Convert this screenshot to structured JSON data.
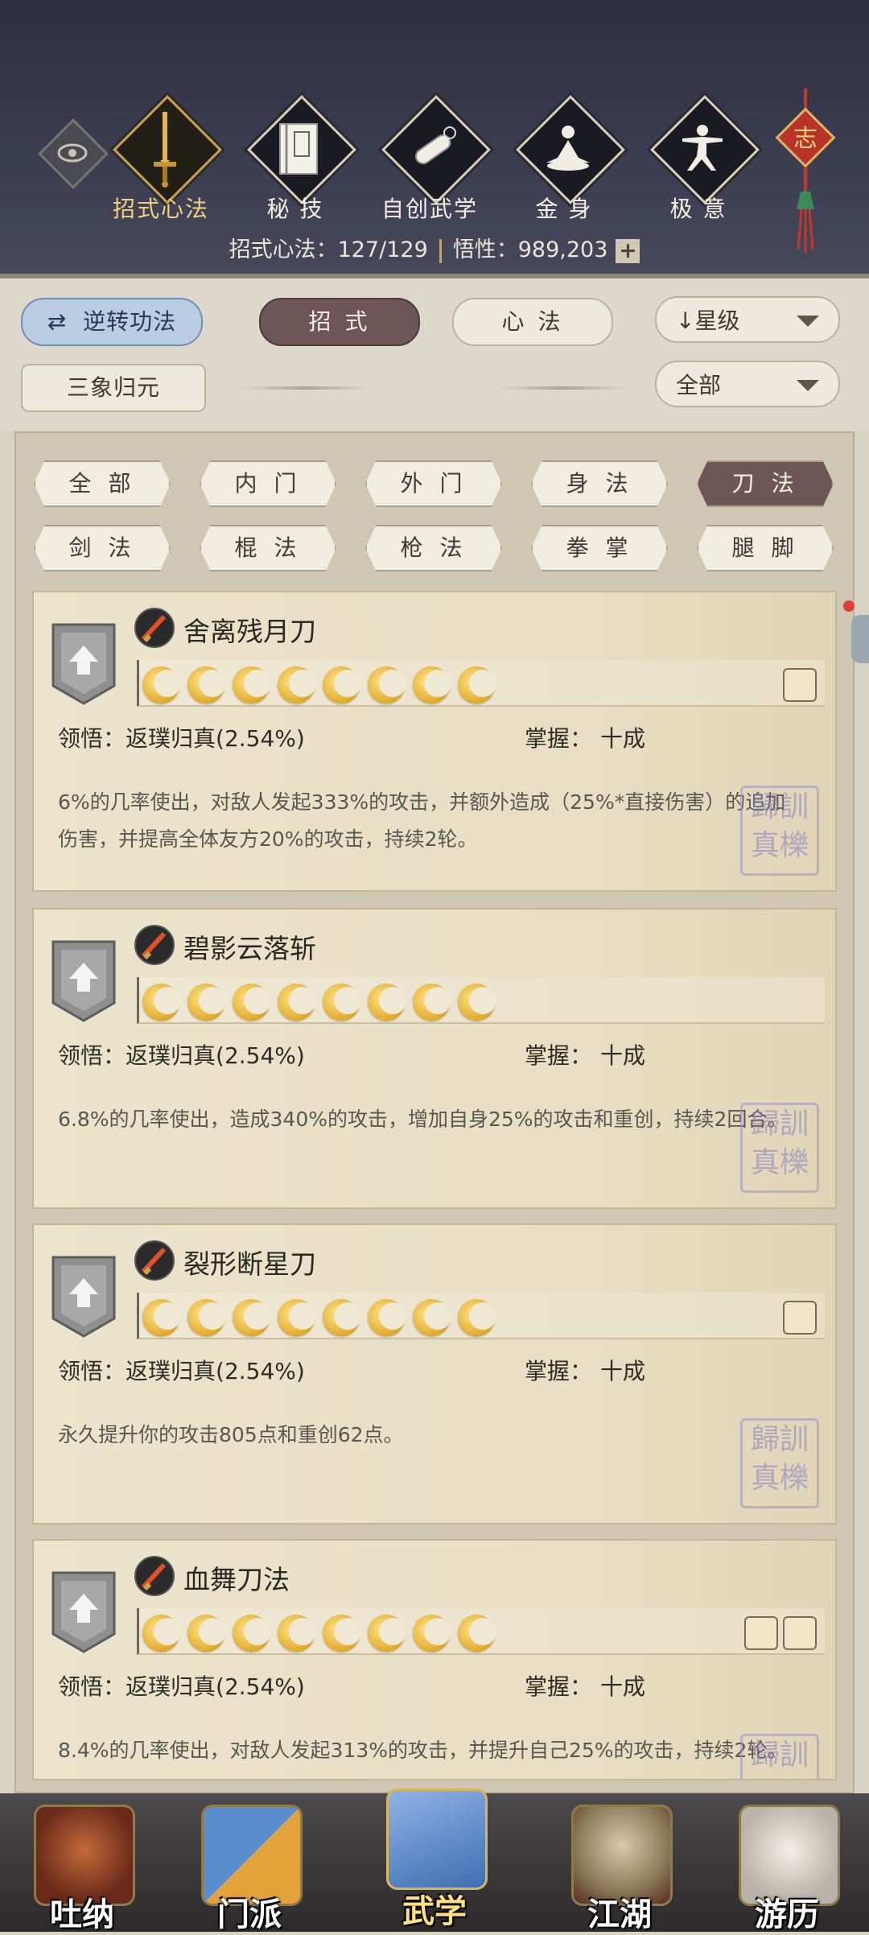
{
  "header": {
    "tabs": [
      {
        "label": "招式心法",
        "icon": "sword-icon",
        "active": true
      },
      {
        "label": "秘 技",
        "icon": "book-icon",
        "active": false
      },
      {
        "label": "自创武学",
        "icon": "scroll-icon",
        "active": false
      },
      {
        "label": "金 身",
        "icon": "meditation-icon",
        "active": false
      },
      {
        "label": "极 意",
        "icon": "martial-stance-icon",
        "active": false
      }
    ],
    "knot_char": "志",
    "stats": {
      "moves_label": "招式心法：",
      "moves_value": "127/129",
      "insight_label": "悟性：",
      "insight_value": "989,203",
      "plus_label": "+"
    }
  },
  "filters": {
    "reverse_label": "逆转功法",
    "moves_tab": "招 式",
    "heart_tab": "心 法",
    "sort_label": "星级",
    "sanxiang_label": "三象归元",
    "scope_label": "全部"
  },
  "categories": [
    "全 部",
    "内 门",
    "外 门",
    "身 法",
    "刀 法",
    "剑 法",
    "棍 法",
    "枪 法",
    "拳 掌",
    "腿 脚"
  ],
  "active_category": "刀 法",
  "cards": [
    {
      "name": "舍离残月刀",
      "stars": 8,
      "insight_label": "领悟：",
      "insight_value": "返璞归真(2.54%)",
      "mastery_label": "掌握：",
      "mastery_value": "十成",
      "desc": "6%的几率使出，对敌人发起333%的攻击，并额外造成（25%*直接伤害）的追加伤害，并提高全体友方20%的攻击，持续2轮。",
      "seal": "歸訓真櫟"
    },
    {
      "name": "碧影云落斩",
      "stars": 8,
      "insight_label": "领悟：",
      "insight_value": "返璞归真(2.54%)",
      "mastery_label": "掌握：",
      "mastery_value": "十成",
      "desc": "6.8%的几率使出，造成340%的攻击，增加自身25%的攻击和重创，持续2回合。",
      "seal": "歸訓真櫟"
    },
    {
      "name": "裂形断星刀",
      "stars": 8,
      "insight_label": "领悟：",
      "insight_value": "返璞归真(2.54%)",
      "mastery_label": "掌握：",
      "mastery_value": "十成",
      "desc": "永久提升你的攻击805点和重创62点。",
      "seal": "歸訓真櫟"
    },
    {
      "name": "血舞刀法",
      "stars": 8,
      "insight_label": "领悟：",
      "insight_value": "返璞归真(2.54%)",
      "mastery_label": "掌握：",
      "mastery_value": "十成",
      "desc": "8.4%的几率使出，对敌人发起313%的攻击，并提升自己25%的攻击，持续2轮。",
      "seal": "歸訓"
    }
  ],
  "bottom_nav": [
    {
      "label": "吐纳",
      "icon": "monk-icon"
    },
    {
      "label": "门派",
      "icon": "sect-flag-icon"
    },
    {
      "label": "武学",
      "icon": "manual-books-icon",
      "active": true
    },
    {
      "label": "江湖",
      "icon": "straw-hat-icon"
    },
    {
      "label": "游历",
      "icon": "horse-icon"
    }
  ],
  "colors": {
    "header_bg": "#3b3c50",
    "active_chip": "#6e5658",
    "moon_gold": "#e0a928",
    "gold_label": "#f1d27a"
  }
}
